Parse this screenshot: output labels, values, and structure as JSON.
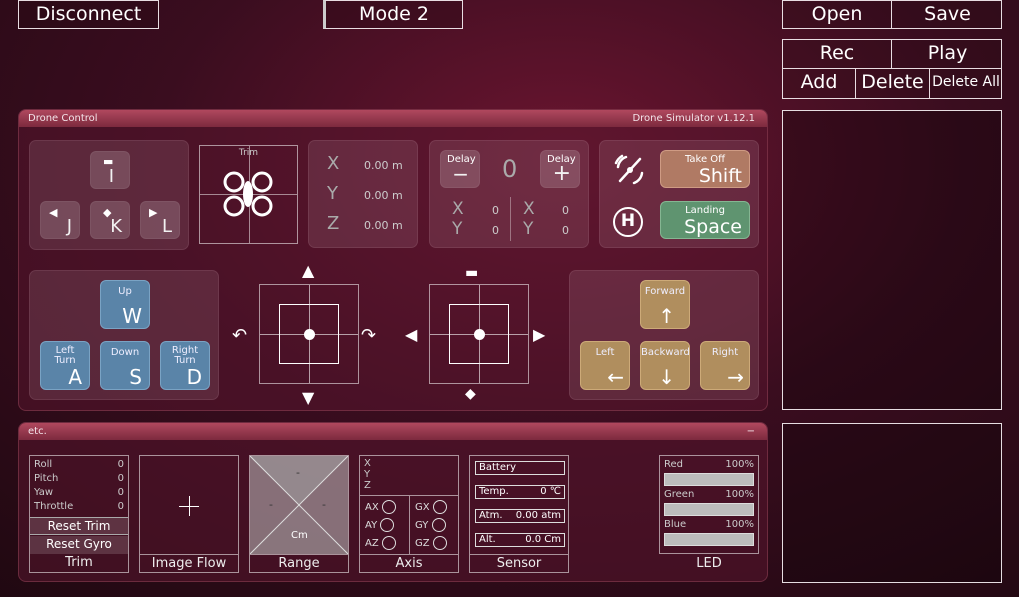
{
  "top": {
    "disconnect_label": "Disconnect",
    "mode_label": "Mode 2",
    "open_label": "Open",
    "save_label": "Save",
    "rec_label": "Rec",
    "play_label": "Play",
    "add_label": "Add",
    "delete_label": "Delete",
    "delete_all_label": "Delete All"
  },
  "drone_panel": {
    "title": "Drone Control",
    "version": "Drone Simulator  v1.12.1",
    "trim_keys": [
      "I",
      "J",
      "K",
      "L"
    ],
    "trim_title": "Trim",
    "position": {
      "x_label": "X",
      "x_value": "0.00 m",
      "y_label": "Y",
      "y_value": "0.00 m",
      "z_label": "Z",
      "z_value": "0.00 m"
    },
    "delay": {
      "label": "Delay",
      "minus": "−",
      "plus": "+",
      "value": "0",
      "left": {
        "x_label": "X",
        "x_value": "0",
        "y_label": "Y",
        "y_value": "0"
      },
      "right": {
        "x_label": "X",
        "x_value": "0",
        "y_label": "Y",
        "y_value": "0"
      }
    },
    "takeoff": {
      "title": "Take Off",
      "key": "Shift"
    },
    "landing": {
      "title": "Landing",
      "key": "Space"
    },
    "left_keys": {
      "up": {
        "title": "Up",
        "key": "W"
      },
      "left_turn": {
        "title": "Left\nTurn",
        "key": "A"
      },
      "down": {
        "title": "Down",
        "key": "S"
      },
      "right_turn": {
        "title": "Right\nTurn",
        "key": "D"
      }
    },
    "right_keys": {
      "forward": {
        "title": "Forward",
        "key": "↑"
      },
      "left": {
        "title": "Left",
        "key": "←"
      },
      "backward": {
        "title": "Backward",
        "key": "↓"
      },
      "right": {
        "title": "Right",
        "key": "→"
      }
    }
  },
  "etc_panel": {
    "title": "etc.",
    "collapse": "−",
    "trim": {
      "rows": [
        {
          "label": "Roll",
          "value": "0"
        },
        {
          "label": "Pitch",
          "value": "0"
        },
        {
          "label": "Yaw",
          "value": "0"
        },
        {
          "label": "Throttle",
          "value": "0"
        }
      ],
      "reset_trim": "Reset Trim",
      "reset_gyro": "Reset Gyro",
      "label": "Trim"
    },
    "image_flow": {
      "label": "Image Flow"
    },
    "range": {
      "label": "Range",
      "top": "-",
      "left": "-",
      "right": "-",
      "unit": "Cm"
    },
    "axis": {
      "label": "Axis",
      "lines": [
        "X",
        "Y",
        "Z"
      ],
      "rows": [
        {
          "a": "AX",
          "g": "GX"
        },
        {
          "a": "AY",
          "g": "GY"
        },
        {
          "a": "AZ",
          "g": "GZ"
        }
      ]
    },
    "sensor": {
      "label": "Sensor",
      "battery": "Battery",
      "temp_label": "Temp.",
      "temp_value": "0 ℃",
      "atm_label": "Atm.",
      "atm_value": "0.00 atm",
      "alt_label": "Alt.",
      "alt_value": "0.0 Cm"
    },
    "led": {
      "label": "LED",
      "channels": [
        {
          "name": "Red",
          "value": "100%"
        },
        {
          "name": "Green",
          "value": "100%"
        },
        {
          "name": "Blue",
          "value": "100%"
        }
      ]
    }
  },
  "icons": {
    "arrow_up": "▲",
    "arrow_down": "▼",
    "arrow_left": "◀",
    "arrow_right": "▶",
    "trim_icon": "arrow-icon",
    "helipad_icon": "H"
  }
}
